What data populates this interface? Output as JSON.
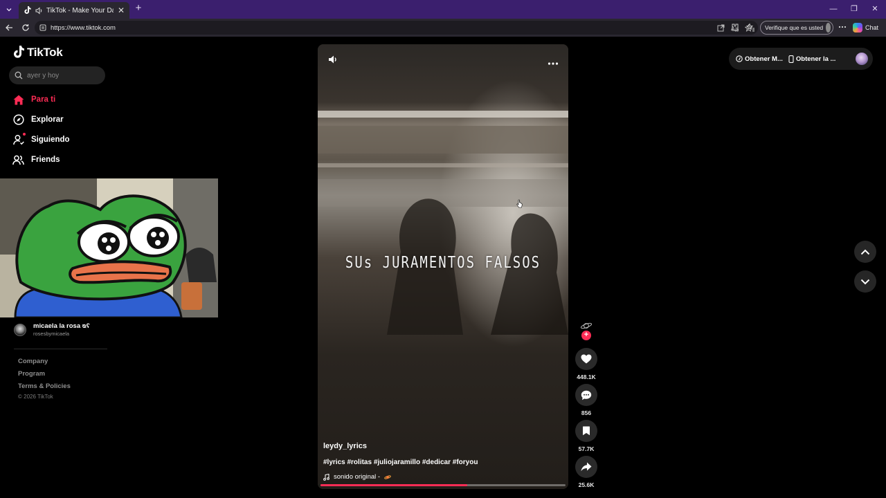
{
  "browser": {
    "tab_title": "TikTok - Make Your Day",
    "url": "https://www.tiktok.com",
    "verify_label": "Verifique que es usted",
    "chat_label": "Chat"
  },
  "sidebar": {
    "logo_text": "TikTok",
    "search_placeholder": "ayer y hoy",
    "nav": [
      {
        "label": "Para ti",
        "icon": "home-icon",
        "active": true
      },
      {
        "label": "Explorar",
        "icon": "compass-icon"
      },
      {
        "label": "Siguiendo",
        "icon": "user-follow-icon"
      },
      {
        "label": "Friends",
        "icon": "friends-icon"
      }
    ],
    "following_account": {
      "name": "micaela la rosa ᴓʕ",
      "handle": "rosesbymicaela"
    },
    "footer": [
      "Company",
      "Program",
      "Terms & Policies"
    ],
    "copyright": "© 2026 TikTok"
  },
  "video": {
    "overlay_text": "SUs JURAMENTOS FALSOS",
    "author": "leydy_lyrics",
    "caption": "#lyrics #rolitas #juliojaramillo #dedicar #foryou",
    "music": "sonido original -",
    "progress": 0.6
  },
  "actions": {
    "likes": "448.1K",
    "comments": "856",
    "saves": "57.7K",
    "shares": "25.6K"
  },
  "topright": {
    "get_coins": "Obtener M...",
    "get_app": "Obtener la ..."
  },
  "colors": {
    "accent": "#fe2c55",
    "tabbar": "#3b1f6e"
  }
}
